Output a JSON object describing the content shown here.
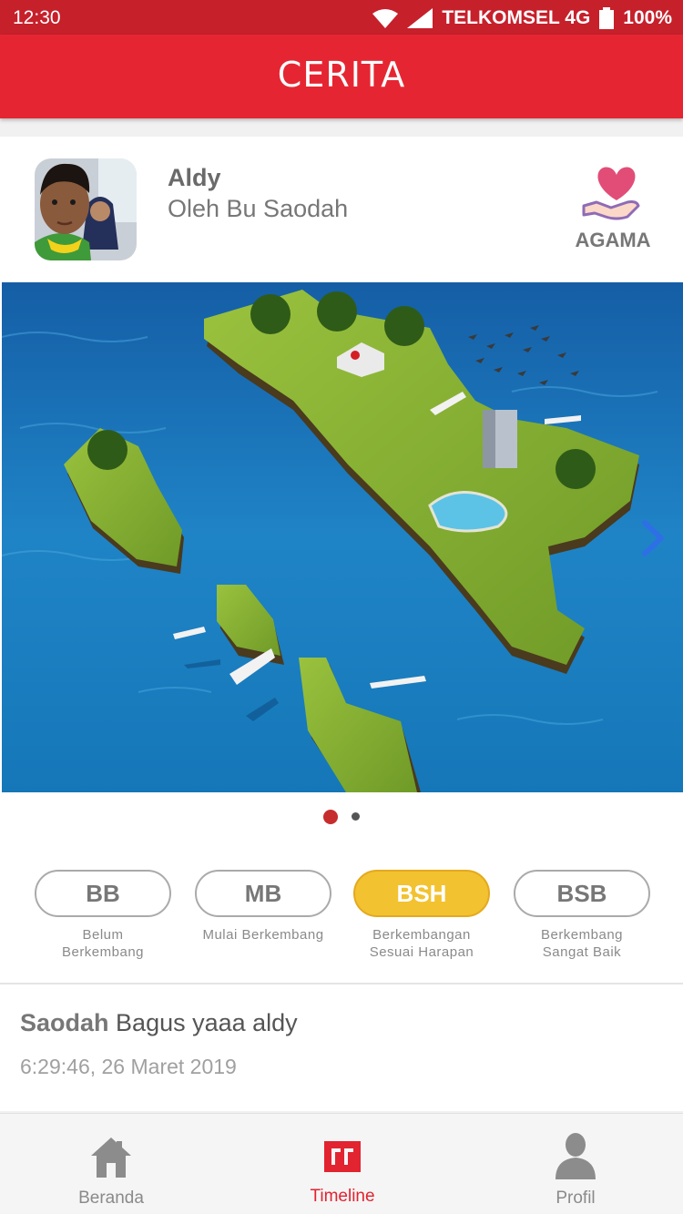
{
  "status_bar": {
    "time": "12:30",
    "carrier": "TELKOMSEL 4G",
    "battery": "100%"
  },
  "app_bar": {
    "title": "CERITA"
  },
  "post": {
    "student_name": "Aldy",
    "author": "Oleh Bu Saodah",
    "category": {
      "label": "AGAMA",
      "icon": "heart-hand-icon"
    },
    "carousel": {
      "page_count": 2,
      "active_index": 0
    }
  },
  "ratings": [
    {
      "code": "BB",
      "desc1": "Belum",
      "desc2": "Berkembang",
      "selected": false
    },
    {
      "code": "MB",
      "desc1": "Mulai Berkembang",
      "desc2": "",
      "selected": false
    },
    {
      "code": "BSH",
      "desc1": "Berkembangan",
      "desc2": "Sesuai Harapan",
      "selected": true
    },
    {
      "code": "BSB",
      "desc1": "Berkembang",
      "desc2": "Sangat Baik",
      "selected": false
    }
  ],
  "comment": {
    "author": "Saodah",
    "text": "Bagus yaaa aldy",
    "time": "6:29:46, 26 Maret 2019"
  },
  "nav": [
    {
      "label": "Beranda",
      "icon": "home-icon",
      "active": false
    },
    {
      "label": "Timeline",
      "icon": "timeline-icon",
      "active": true
    },
    {
      "label": "Profil",
      "icon": "profile-icon",
      "active": false
    }
  ],
  "colors": {
    "primary": "#e52632",
    "status_bar": "#c6202b",
    "selected_rating": "#f2c230"
  }
}
